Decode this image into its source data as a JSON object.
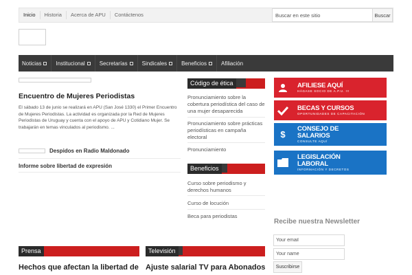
{
  "topbar": {
    "links": [
      "Inicio",
      "Historia",
      "Acerca de APU",
      "Contáctenos"
    ],
    "search_placeholder": "Buscar en este sitio",
    "search_button": "Buscar"
  },
  "nav": {
    "items": [
      "Noticias",
      "Institucional",
      "Secretarías",
      "Sindicales",
      "Beneficios",
      "Afiliación"
    ]
  },
  "featured": {
    "title": "Encuentro de Mujeres Periodistas",
    "excerpt": "El sábado 13 de junio se realizará en APU (San José 1330) el Primer Encuentro de Mujeres Periodistas. La actividad es organizada por la Red de Mujeres Periodistas de Uruguay y cuenta con el apoyo de APU y Cotidiano Mujer. Se trabajarán en temas vinculados al periodismo. ..."
  },
  "list": {
    "item1": "Despidos en Radio Maldonado",
    "item2": "Informe sobre libertad de expresión"
  },
  "codigo": {
    "heading": "Código de ética",
    "items": [
      "Pronunciamiento sobre la cobertura periodística del caso de una mujer desaparecida",
      "Pronunciamiento sobre prácticas periodísticas en campaña electoral",
      "Pronunciamiento"
    ]
  },
  "beneficios": {
    "heading": "Beneficios",
    "items": [
      "Curso sobre periodismo y derechos humanos",
      "Curso de locución",
      "Beca para periodistas"
    ]
  },
  "banners": [
    {
      "title": "AFILIESE AQUÍ",
      "subtitle": "HÁGASE SOCIO DE A.P.U. !!!",
      "icon": "user-icon",
      "color": "#d9232d"
    },
    {
      "title": "BECAS Y CURSOS",
      "subtitle": "OPORTUNIDADES DE CAPACITACIÓN",
      "icon": "check-icon",
      "color": "#d9232d"
    },
    {
      "title": "CONSEJO DE SALARIOS",
      "subtitle": "CONSULTE AQUÍ",
      "icon": "dollar-icon",
      "color": "#1a73c5"
    },
    {
      "title": "LEGISLACIÓN LABORAL",
      "subtitle": "INFORMACIÓN Y DECRETOS",
      "icon": "folder-icon",
      "color": "#1a73c5"
    }
  ],
  "newsletter": {
    "title": "Recibe nuestra Newsletter",
    "email_placeholder": "Your email",
    "name_placeholder": "Your name",
    "button": "Suscribirse"
  },
  "prensa": {
    "heading": "Prensa",
    "title": "Hechos que afectan la libertad de"
  },
  "television": {
    "heading": "Televisión",
    "title": "Ajuste salarial TV para Abonados"
  }
}
